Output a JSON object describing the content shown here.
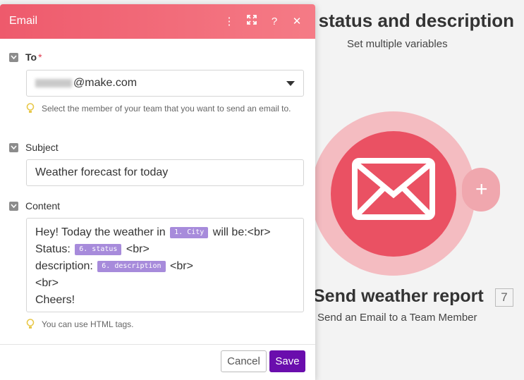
{
  "background": {
    "title": "e status and description",
    "subtitle": "Set multiple variables",
    "module": {
      "name": "Send weather report",
      "id": "7",
      "description": "Send an Email to a Team Member",
      "color": "#ea5163"
    }
  },
  "panel": {
    "title": "Email",
    "header_gradient": [
      "#ee5a6c",
      "#f57b86"
    ],
    "icons": [
      "more-vertical-icon",
      "expand-icon",
      "help-icon",
      "close-icon"
    ],
    "to": {
      "label": "To",
      "required_mark": "*",
      "value": "@make.com",
      "hint": "Select the member of your team that you want to send an email to."
    },
    "subject": {
      "label": "Subject",
      "value": "Weather forecast for today"
    },
    "content": {
      "label": "Content",
      "line1_text": "Hey! Today the weather in ",
      "line1_pill": "1. City",
      "line1_after": " will be:<br>",
      "line2_text": "Status: ",
      "line2_pill": "6. status",
      "line2_after": " <br>",
      "line3_text": "description: ",
      "line3_pill": "6. description",
      "line3_after": " <br>",
      "line4": "<br>",
      "line5": "Cheers!",
      "hint": "You can use HTML tags."
    },
    "buttons": {
      "cancel": "Cancel",
      "save": "Save",
      "save_color": "#6a0dad"
    }
  }
}
